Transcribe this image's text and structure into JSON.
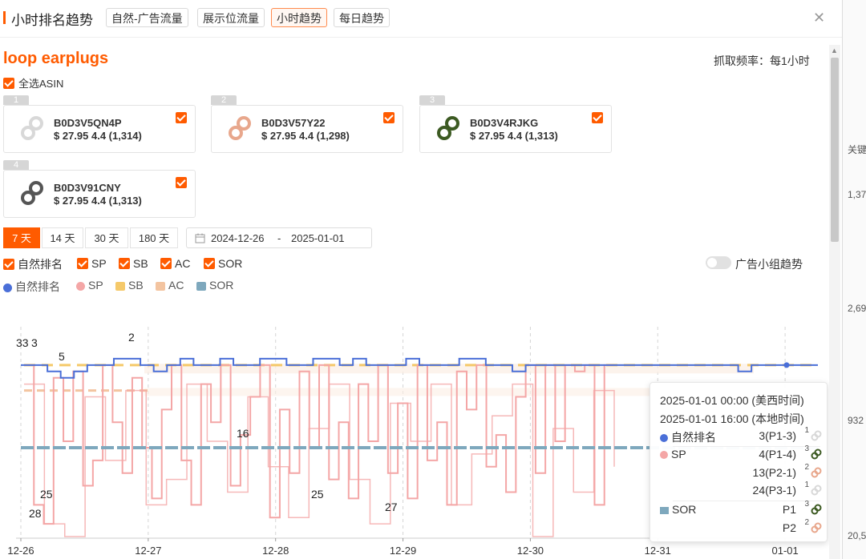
{
  "header": {
    "title": "小时排名趋势",
    "tabs": [
      {
        "label": "自然-广告流量",
        "active": false
      },
      {
        "label": "展示位流量",
        "active": false
      },
      {
        "label": "小时趋势",
        "active": true
      },
      {
        "label": "每日趋势",
        "active": false
      }
    ],
    "close_icon": "close-icon"
  },
  "keyword": "loop earplugs",
  "frequency": "抓取频率：每1小时",
  "select_all": "全选ASIN",
  "products": [
    {
      "num": "1",
      "asin": "B0D3V5QN4P",
      "price": "$ 27.95 4.4 (1,314)",
      "color": "#d8d8d8",
      "checked": true
    },
    {
      "num": "2",
      "asin": "B0D3V57Y22",
      "price": "$ 27.95 4.4 (1,298)",
      "color": "#e8a78c",
      "checked": true
    },
    {
      "num": "3",
      "asin": "B0D3V4RJKG",
      "price": "$ 27.95 4.4 (1,313)",
      "color": "#3c5a22",
      "checked": true
    },
    {
      "num": "4",
      "asin": "B0D3V91CNY",
      "price": "$ 27.95 4.4 (1,313)",
      "color": "#555555",
      "checked": true
    }
  ],
  "ranges": [
    {
      "label": "7 天",
      "active": true
    },
    {
      "label": "14 天",
      "active": false
    },
    {
      "label": "30 天",
      "active": false
    },
    {
      "label": "180 天",
      "active": false
    }
  ],
  "date_range": {
    "start": "2024-12-26",
    "sep": "-",
    "end": "2025-01-01"
  },
  "filters": [
    "自然排名",
    "SP",
    "SB",
    "AC",
    "SOR"
  ],
  "toggle_label": "广告小组趋势",
  "legend": [
    {
      "name": "自然排名",
      "color": "#4a6fd8",
      "shape": "dot"
    },
    {
      "name": "SP",
      "color": "#f4a6a6",
      "shape": "dot"
    },
    {
      "name": "SB",
      "color": "#f5c96a",
      "shape": "square"
    },
    {
      "name": "AC",
      "color": "#f3c4a0",
      "shape": "square"
    },
    {
      "name": "SOR",
      "color": "#7ea8bd",
      "shape": "square"
    }
  ],
  "chart_data": {
    "type": "line",
    "x_ticks": [
      "12-26",
      "12-27",
      "12-28",
      "12-29",
      "12-30",
      "12-31",
      "01-01"
    ],
    "annotations": [
      "33",
      "3",
      "5",
      "2",
      "16",
      "25",
      "28",
      "25",
      "27"
    ],
    "series": [
      {
        "name": "自然排名",
        "color": "#4a6fd8",
        "values": [
          3,
          3,
          4,
          5,
          4,
          3,
          3,
          2,
          2,
          3,
          4,
          3,
          2,
          3,
          3,
          2,
          3,
          3,
          2,
          2,
          3,
          3,
          2,
          2,
          3,
          2,
          3,
          3,
          3,
          2,
          3,
          3,
          3,
          2,
          2,
          3,
          3,
          4,
          3,
          3,
          3,
          3,
          3,
          3,
          3,
          3,
          3,
          3,
          3,
          3,
          3,
          3,
          3,
          3,
          4,
          3,
          3,
          3,
          3,
          3,
          3
        ]
      },
      {
        "name": "SP",
        "color": "#f4a6a6",
        "values": [
          3,
          25,
          28,
          5,
          15,
          4,
          22,
          18,
          3,
          12,
          20,
          5,
          16,
          24,
          10,
          3,
          18,
          25,
          6,
          12,
          3,
          22,
          14,
          8,
          3,
          27,
          10,
          20,
          4,
          16,
          3,
          21,
          12,
          24,
          6,
          15,
          3,
          20,
          9,
          24,
          3,
          18,
          12,
          25,
          4,
          10,
          3,
          19,
          14,
          23,
          8,
          3,
          20,
          3,
          15,
          3,
          4,
          3,
          25,
          3,
          3
        ]
      },
      {
        "name": "SB",
        "color": "#f5c96a",
        "values": [
          3,
          3,
          3,
          3,
          3,
          3,
          3,
          3,
          3,
          3,
          3,
          3,
          3,
          3,
          3,
          3,
          3,
          3,
          3,
          3,
          3,
          3,
          3,
          3,
          3,
          3,
          3,
          3,
          3,
          3,
          3,
          3,
          3,
          3,
          3,
          3,
          3,
          3,
          3,
          3,
          3,
          3,
          3,
          3,
          3,
          3,
          3,
          3,
          3,
          3
        ]
      },
      {
        "name": "AC",
        "color": "#f3c4a0",
        "values": [
          7,
          7,
          7,
          7,
          7,
          7,
          7,
          7,
          7,
          7,
          7,
          7,
          7,
          7,
          7,
          7,
          7,
          7,
          7,
          7
        ]
      },
      {
        "name": "SOR",
        "color": "#7ea8bd",
        "values": [
          16,
          16,
          16,
          16,
          16,
          16,
          16,
          16,
          16,
          16,
          16,
          16,
          16,
          16,
          16,
          16,
          16,
          16,
          16,
          16,
          16,
          16,
          16,
          16,
          16,
          16,
          16,
          16,
          16,
          16,
          16,
          16,
          16,
          16,
          16,
          16,
          16,
          16,
          16,
          16,
          16,
          16,
          16,
          16,
          16,
          16,
          16,
          16,
          16,
          16,
          16,
          16,
          16,
          16,
          16
        ]
      }
    ],
    "ylim": [
      1,
      30
    ]
  },
  "tooltip": {
    "time_us": "2025-01-01 00:00 (美西时间)",
    "time_local": "2025-01-01 16:00 (本地时间)",
    "rows": [
      {
        "series": "自然排名",
        "value": "3(P1-3)",
        "sup": "1",
        "color": "#4a6fd8",
        "shape": "dot",
        "img": "#d8d8d8"
      },
      {
        "series": "SP",
        "value": "4(P1-4)",
        "sup": "3",
        "color": "#f4a6a6",
        "shape": "dot",
        "img": "#3c5a22"
      },
      {
        "series": "",
        "value": "13(P2-1)",
        "sup": "2",
        "color": "",
        "shape": "",
        "img": "#e8a78c"
      },
      {
        "series": "",
        "value": "24(P3-1)",
        "sup": "1",
        "color": "",
        "shape": "",
        "img": "#d8d8d8"
      },
      {
        "series": "SOR",
        "value": "P1",
        "sup": "3",
        "color": "#7ea8bd",
        "shape": "square",
        "img": "#3c5a22"
      },
      {
        "series": "",
        "value": "P2",
        "sup": "2",
        "color": "",
        "shape": "",
        "img": "#e8a78c"
      }
    ]
  },
  "right_panel": [
    "关键",
    "1,37",
    "2,69",
    "932",
    "20,5"
  ]
}
